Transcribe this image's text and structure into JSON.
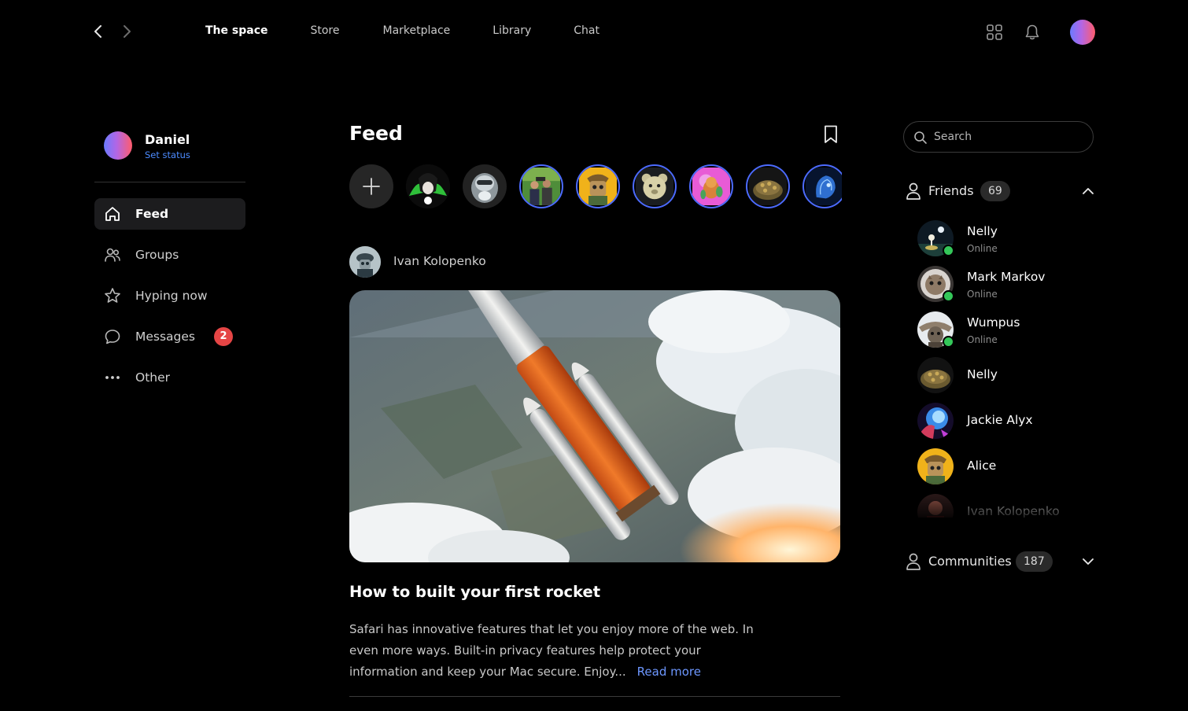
{
  "nav": {
    "back_icon": "chevron-left-icon",
    "forward_icon": "chevron-right-icon",
    "tabs": [
      {
        "label": "The space",
        "active": true
      },
      {
        "label": "Store",
        "active": false
      },
      {
        "label": "Marketplace",
        "active": false
      },
      {
        "label": "Library",
        "active": false
      },
      {
        "label": "Chat",
        "active": false
      }
    ],
    "icons": [
      "apps-grid-icon",
      "bell-icon"
    ]
  },
  "profile": {
    "name": "Daniel",
    "status_link": "Set status"
  },
  "sidebar": {
    "items": [
      {
        "label": "Feed",
        "icon": "home-icon",
        "active": true
      },
      {
        "label": "Groups",
        "icon": "people-icon",
        "active": false
      },
      {
        "label": "Hyping now",
        "icon": "star-icon",
        "active": false
      },
      {
        "label": "Messages",
        "icon": "chat-bubble-icon",
        "active": false,
        "badge": "2"
      },
      {
        "label": "Other",
        "icon": "more-dots-icon",
        "active": false
      }
    ]
  },
  "feed": {
    "title": "Feed",
    "bookmark_icon": "bookmark-icon",
    "add_story_icon": "plus-icon",
    "post": {
      "author": "Ivan Kolopenko",
      "title": "How to built your first rocket",
      "body": "Safari has innovative features that let you enjoy more of the web. In even more ways. Built-in privacy features help protect your information and keep your Mac secure. Enjoy...",
      "read_more": "Read more"
    }
  },
  "search": {
    "placeholder": "Search"
  },
  "friends": {
    "title": "Friends",
    "count": "69",
    "expanded": true,
    "items": [
      {
        "name": "Nelly",
        "status": "Online",
        "online": true
      },
      {
        "name": "Mark Markov",
        "status": "Online",
        "online": true
      },
      {
        "name": "Wumpus",
        "status": "Online",
        "online": true
      },
      {
        "name": "Nelly",
        "status": "",
        "online": false
      },
      {
        "name": "Jackie Alyx",
        "status": "",
        "online": false
      },
      {
        "name": "Alice",
        "status": "",
        "online": false
      },
      {
        "name": "Ivan Kolopenko",
        "status": "",
        "online": false
      }
    ]
  },
  "communities": {
    "title": "Communities",
    "count": "187",
    "expanded": false
  },
  "colors": {
    "background": "#000000",
    "accent_blue": "#4c8bff",
    "read_more": "#6d97ff",
    "badge_red": "#e54545",
    "online_green": "#34c759"
  }
}
